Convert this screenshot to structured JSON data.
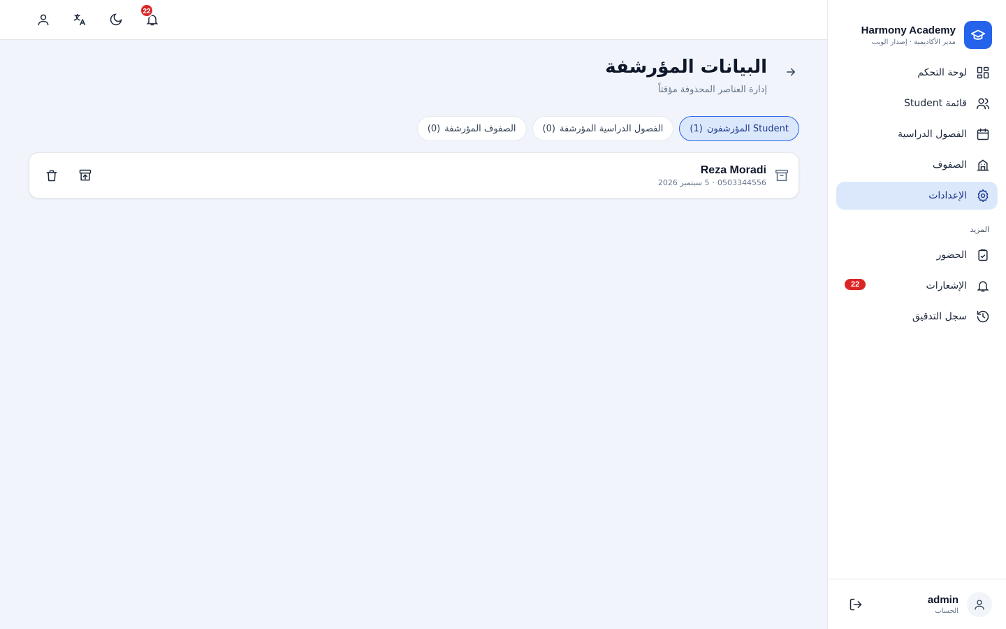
{
  "brand": {
    "name": "Harmony Academy",
    "subtitle": "مدير الأكاديمية · إصدار الويب",
    "accent": "#2563eb"
  },
  "sidebar": {
    "items": [
      {
        "label": "لوحة التحكم",
        "icon": "dashboard-icon",
        "active": false
      },
      {
        "label": "قائمة Student",
        "icon": "users-icon",
        "active": false
      },
      {
        "label": "الفصول الدراسية",
        "icon": "calendar-icon",
        "active": false
      },
      {
        "label": "الصفوف",
        "icon": "building-icon",
        "active": false
      },
      {
        "label": "الإعدادات",
        "icon": "gear-icon",
        "active": true
      }
    ],
    "more_section_label": "المزيد",
    "more_items": [
      {
        "label": "الحضور",
        "icon": "clipboard-icon"
      },
      {
        "label": "الإشعارات",
        "icon": "bell-icon",
        "badge": "22"
      },
      {
        "label": "سجل التدقيق",
        "icon": "history-icon"
      }
    ]
  },
  "account": {
    "name": "admin",
    "role": "الحساب"
  },
  "topbar": {
    "notification_count": "22",
    "badge_color": "#dc2626"
  },
  "page": {
    "title": "البيانات المؤرشفة",
    "subtitle": "إدارة العناصر المحذوفة مؤقتاً"
  },
  "tabs": [
    {
      "label": "Student المؤرشفون",
      "count": "(1)",
      "active": true
    },
    {
      "label": "الفصول الدراسية المؤرشفة",
      "count": "(0)",
      "active": false
    },
    {
      "label": "الصفوف المؤرشفة",
      "count": "(0)",
      "active": false
    }
  ],
  "records": [
    {
      "name": "Reza Moradi",
      "phone": "0503344556",
      "separator": "·",
      "date": "5 سبتمبر 2026"
    }
  ]
}
